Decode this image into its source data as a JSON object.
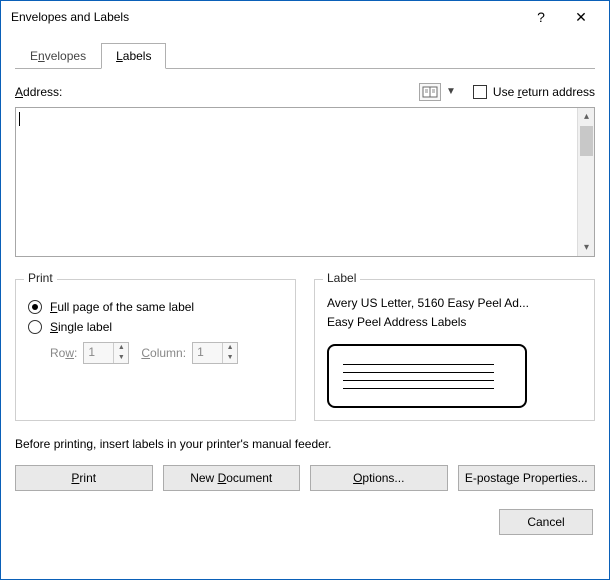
{
  "window": {
    "title": "Envelopes and Labels"
  },
  "tabs": {
    "envelopes_pre": "E",
    "envelopes_u": "n",
    "envelopes_post": "velopes",
    "labels_u": "L",
    "labels_post": "abels"
  },
  "address": {
    "label_u": "A",
    "label_post": "ddress:",
    "use_return_pre": "Use ",
    "use_return_u": "r",
    "use_return_post": "eturn address",
    "value": ""
  },
  "print_group": {
    "legend": "Print",
    "full_u": "F",
    "full_post": "ull page of the same label",
    "single_u": "S",
    "single_post": "ingle label",
    "row_label_pre": "Ro",
    "row_label_u": "w",
    "row_label_post": ":",
    "row_value": "1",
    "col_label_u": "C",
    "col_label_post": "olumn:",
    "col_value": "1"
  },
  "label_group": {
    "legend": "Label",
    "line1": "Avery US Letter, 5160 Easy Peel Ad...",
    "line2": "Easy Peel Address Labels"
  },
  "hint": "Before printing, insert labels in your printer's manual feeder.",
  "buttons": {
    "print_u": "P",
    "print_post": "rint",
    "newdoc_pre": "New ",
    "newdoc_u": "D",
    "newdoc_post": "ocument",
    "options_u": "O",
    "options_post": "ptions...",
    "epost_pre": "E-posta",
    "epost_u": "g",
    "epost_post": "e Properties...",
    "cancel": "Cancel"
  }
}
